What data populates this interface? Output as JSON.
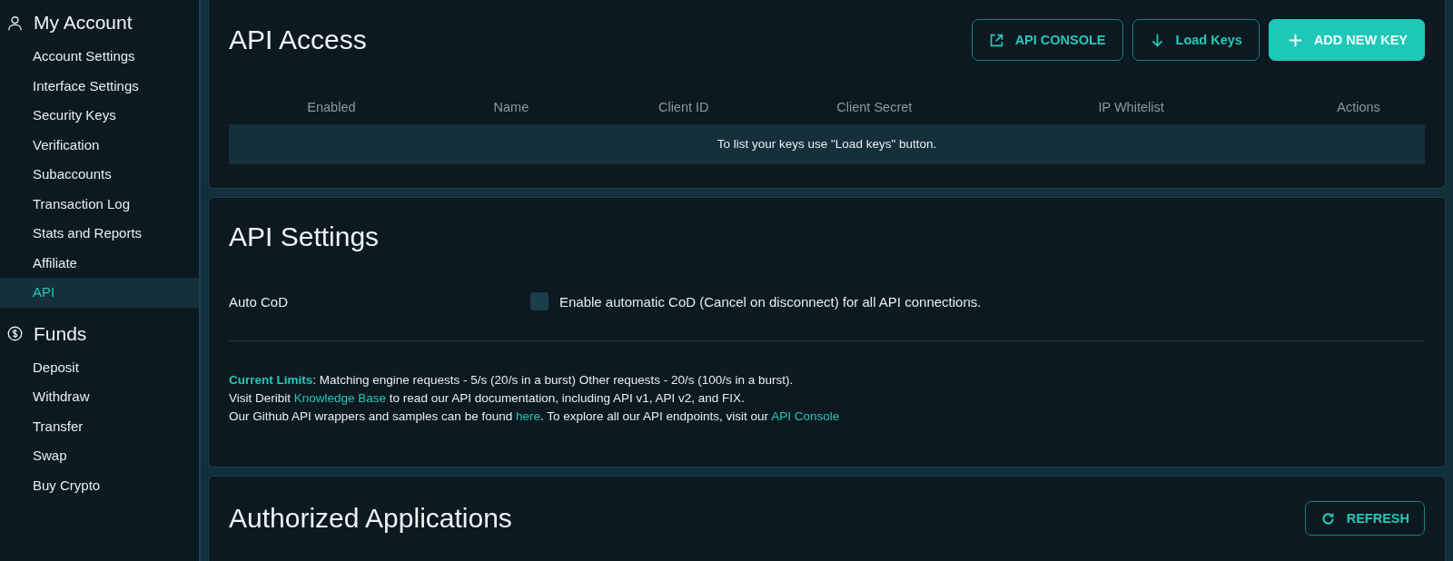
{
  "sidebar": {
    "sections": [
      {
        "title": "My Account",
        "items": [
          {
            "label": "Account Settings",
            "selected": false
          },
          {
            "label": "Interface Settings",
            "selected": false
          },
          {
            "label": "Security Keys",
            "selected": false
          },
          {
            "label": "Verification",
            "selected": false
          },
          {
            "label": "Subaccounts",
            "selected": false
          },
          {
            "label": "Transaction Log",
            "selected": false
          },
          {
            "label": "Stats and Reports",
            "selected": false
          },
          {
            "label": "Affiliate",
            "selected": false
          },
          {
            "label": "API",
            "selected": true
          }
        ]
      },
      {
        "title": "Funds",
        "items": [
          {
            "label": "Deposit",
            "selected": false
          },
          {
            "label": "Withdraw",
            "selected": false
          },
          {
            "label": "Transfer",
            "selected": false
          },
          {
            "label": "Swap",
            "selected": false
          },
          {
            "label": "Buy Crypto",
            "selected": false
          }
        ]
      }
    ]
  },
  "api_access": {
    "title": "API Access",
    "buttons": [
      {
        "label": "API CONSOLE",
        "kind": "outline"
      },
      {
        "label": "Load Keys",
        "kind": "outline"
      },
      {
        "label": "ADD NEW KEY",
        "kind": "filled"
      }
    ],
    "table": {
      "columns": [
        "Enabled",
        "Name",
        "Client ID",
        "Client Secret",
        "IP Whitelist",
        "Actions"
      ],
      "empty_message": "To list your keys use \"Load keys\" button."
    }
  },
  "api_settings": {
    "title": "API Settings",
    "auto_cod": {
      "label": "Auto CoD",
      "checked": false,
      "description": "Enable automatic CoD (Cancel on disconnect) for all API connections."
    },
    "info_lines": [
      [
        {
          "text": "Current Limits",
          "kind": "label"
        },
        {
          "text": ": Matching engine requests - 5/s (20/s in a burst) Other requests - 20/s (100/s in a burst).",
          "kind": "plain"
        }
      ],
      [
        {
          "text": "Visit Deribit ",
          "kind": "plain"
        },
        {
          "text": "Knowledge Base",
          "kind": "link"
        },
        {
          "text": " to read our API documentation, including API v1, API v2, and FIX.",
          "kind": "plain"
        }
      ],
      [
        {
          "text": "Our Github API wrappers and samples can be found ",
          "kind": "plain"
        },
        {
          "text": "here",
          "kind": "link"
        },
        {
          "text": ". To explore all our API endpoints, visit our ",
          "kind": "plain"
        },
        {
          "text": "API Console",
          "kind": "link"
        }
      ]
    ]
  },
  "authorized_applications": {
    "title": "Authorized Applications",
    "button": {
      "label": "REFRESH"
    }
  }
}
